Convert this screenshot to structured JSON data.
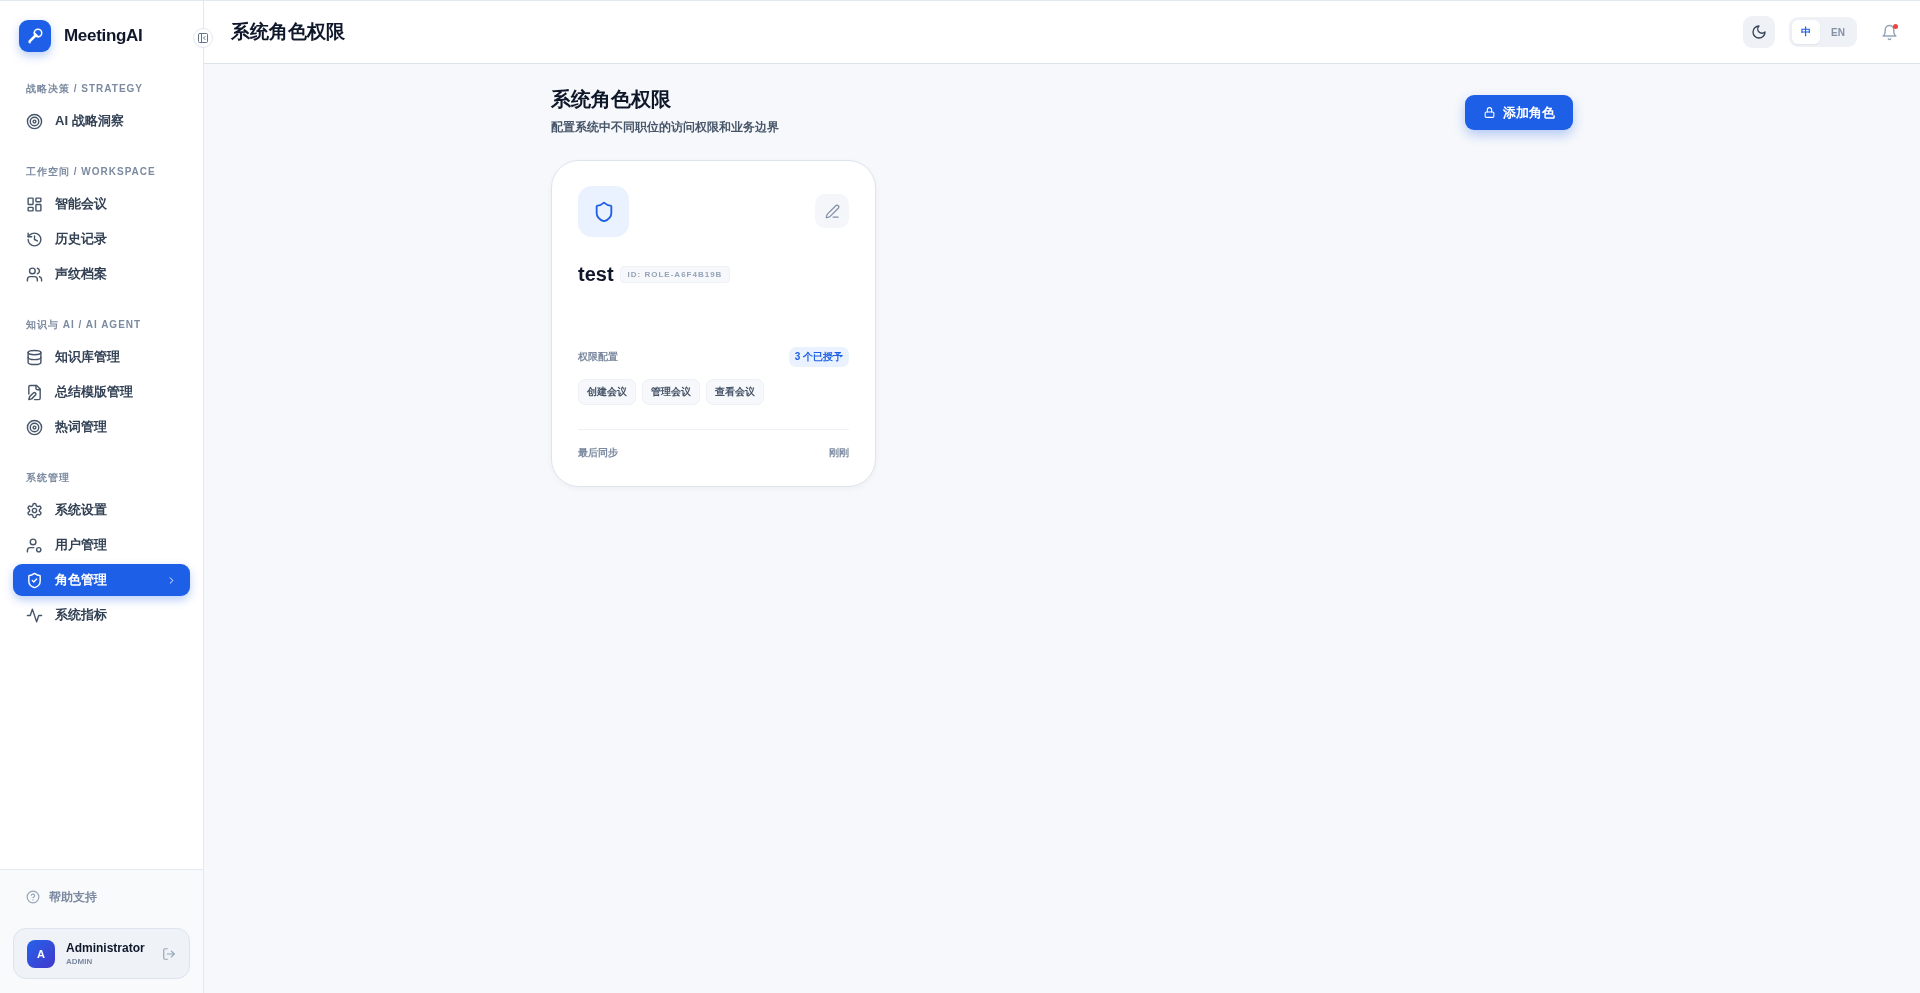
{
  "sidebar": {
    "brand": "MeetingAI",
    "sections": [
      {
        "title": "战略决策 / STRATEGY",
        "items": [
          {
            "label": "AI 战略洞察",
            "selected": false
          }
        ]
      },
      {
        "title": "工作空间 / WORKSPACE",
        "items": [
          {
            "label": "智能会议",
            "selected": false
          },
          {
            "label": "历史记录",
            "selected": false
          },
          {
            "label": "声纹档案",
            "selected": false
          }
        ]
      },
      {
        "title": "知识与 AI / AI AGENT",
        "items": [
          {
            "label": "知识库管理",
            "selected": false
          },
          {
            "label": "总结模版管理",
            "selected": false
          },
          {
            "label": "热词管理",
            "selected": false
          }
        ]
      },
      {
        "title": "系统管理",
        "items": [
          {
            "label": "系统设置",
            "selected": false
          },
          {
            "label": "用户管理",
            "selected": false
          },
          {
            "label": "角色管理",
            "selected": true
          },
          {
            "label": "系统指标",
            "selected": false
          }
        ]
      }
    ],
    "help": "帮助支持",
    "user": {
      "avatar": "A",
      "name": "Administrator",
      "role": "ADMIN"
    }
  },
  "header": {
    "title": "系统角色权限",
    "languages": [
      {
        "label": "中",
        "selected": true
      },
      {
        "label": "EN",
        "selected": false
      }
    ],
    "notification_unread": true
  },
  "page": {
    "title": "系统角色权限",
    "subtitle": "配置系统中不同职位的访问权限和业务边界",
    "add_button": "添加角色",
    "roles": [
      {
        "name": "test",
        "id": "ID: ROLE-A6F4B19B",
        "permissions_label": "权限配置",
        "granted": "3 个已授予",
        "permissions": [
          "创建会议",
          "管理会议",
          "查看会议"
        ],
        "sync_label": "最后同步",
        "sync_time": "刚刚"
      }
    ]
  }
}
